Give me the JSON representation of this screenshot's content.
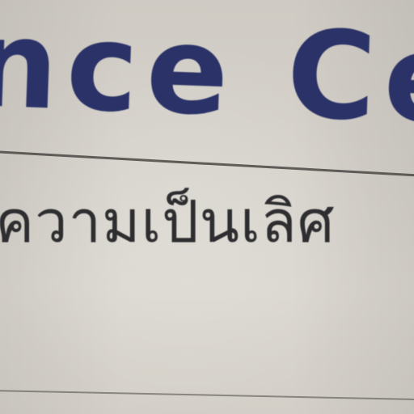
{
  "sign": {
    "headline": "nce Ce",
    "thai_line": "ความเป็นเลิศ"
  },
  "colors": {
    "headline": "#2a3268",
    "thai_text": "#2e2e30",
    "background": "#d6d2cb",
    "rule": "#4a4844"
  }
}
